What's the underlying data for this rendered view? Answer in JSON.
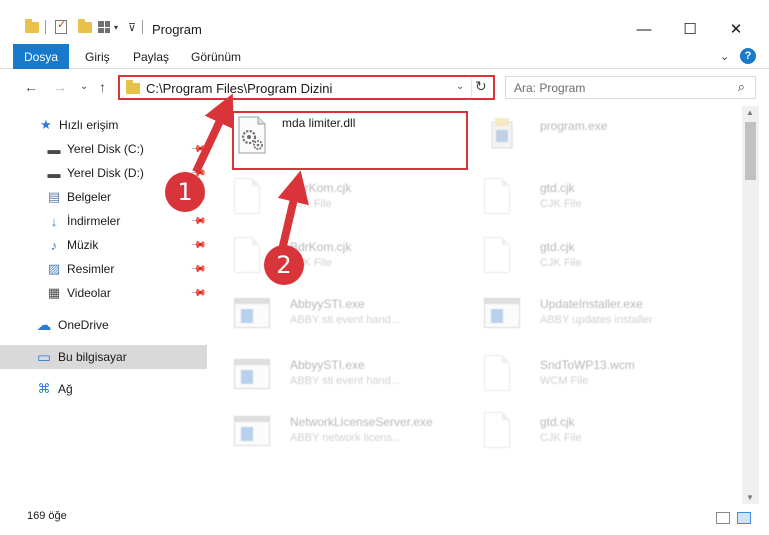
{
  "window": {
    "title": "Program",
    "minimize": "—",
    "maximize": "☐",
    "close": "✕"
  },
  "ribbon": {
    "tabs": [
      "Dosya",
      "Giriş",
      "Paylaş",
      "Görünüm"
    ],
    "expand": "⌄",
    "help": "?"
  },
  "nav": {
    "back": "←",
    "forward": "→",
    "recent": "⌄",
    "up": "↑",
    "address": "C:\\Program Files\\Program Dizini",
    "address_dropdown": "⌄",
    "refresh": "↻",
    "search_placeholder": "Ara: Program",
    "search_icon": "⌕"
  },
  "sidebar": {
    "items": [
      {
        "label": "Hızlı erişim",
        "icon": "star-icon",
        "glyph": "★",
        "color": "#2b7bd4",
        "pinned": false
      },
      {
        "label": "Yerel Disk (C:)",
        "icon": "drive-icon",
        "glyph": "▬",
        "color": "#4a4a4a",
        "pinned": true
      },
      {
        "label": "Yerel Disk (D:)",
        "icon": "drive-icon",
        "glyph": "▬",
        "color": "#4a4a4a",
        "pinned": true
      },
      {
        "label": "Belgeler",
        "icon": "documents-icon",
        "glyph": "▤",
        "color": "#5b7fa6",
        "pinned": true
      },
      {
        "label": "İndirmeler",
        "icon": "download-icon",
        "glyph": "↓",
        "color": "#2b7bd4",
        "pinned": true
      },
      {
        "label": "Müzik",
        "icon": "music-icon",
        "glyph": "♪",
        "color": "#2b7bd4",
        "pinned": true
      },
      {
        "label": "Resimler",
        "icon": "pictures-icon",
        "glyph": "▨",
        "color": "#4a7fb5",
        "pinned": true
      },
      {
        "label": "Videolar",
        "icon": "videos-icon",
        "glyph": "▦",
        "color": "#4a4a4a",
        "pinned": true
      },
      {
        "label": "OneDrive",
        "icon": "cloud-icon",
        "glyph": "☁",
        "color": "#2b7bd4",
        "pinned": false
      },
      {
        "label": "Bu bilgisayar",
        "icon": "computer-icon",
        "glyph": "▭",
        "color": "#2b7bd4",
        "pinned": false
      },
      {
        "label": "Ağ",
        "icon": "network-icon",
        "glyph": "⌘",
        "color": "#2b7bd4",
        "pinned": false
      }
    ]
  },
  "files": {
    "highlighted": {
      "name": "mda limiter.dll"
    },
    "col1": [
      {
        "name": "BdrKom.cjk",
        "type": "CJK File",
        "kind": "doc"
      },
      {
        "name": "BdrKom.cjk",
        "type": "CJK File",
        "kind": "doc"
      },
      {
        "name": "AbbyySTI.exe",
        "type": "ABBY sti event hand...",
        "kind": "exe"
      },
      {
        "name": "AbbyySTI.exe",
        "type": "ABBY sti event hand...",
        "kind": "exe"
      },
      {
        "name": "NetworkLicenseServer.exe",
        "type": "ABBY network licens...",
        "kind": "exe"
      }
    ],
    "col2": [
      {
        "name": "program.exe",
        "type": "",
        "kind": "app"
      },
      {
        "name": "gtd.cjk",
        "type": "CJK File",
        "kind": "doc"
      },
      {
        "name": "gtd.cjk",
        "type": "CJK File",
        "kind": "doc"
      },
      {
        "name": "UpdateInstaller.exe",
        "type": "ABBY updates installer",
        "kind": "exe"
      },
      {
        "name": "SndToWP13.wcm",
        "type": "WCM File",
        "kind": "doc"
      },
      {
        "name": "gtd.cjk",
        "type": "CJK File",
        "kind": "doc"
      }
    ]
  },
  "annotations": {
    "marker1": "1",
    "marker2": "2",
    "color": "#d9343a"
  },
  "status": {
    "count": "169 öğe"
  }
}
